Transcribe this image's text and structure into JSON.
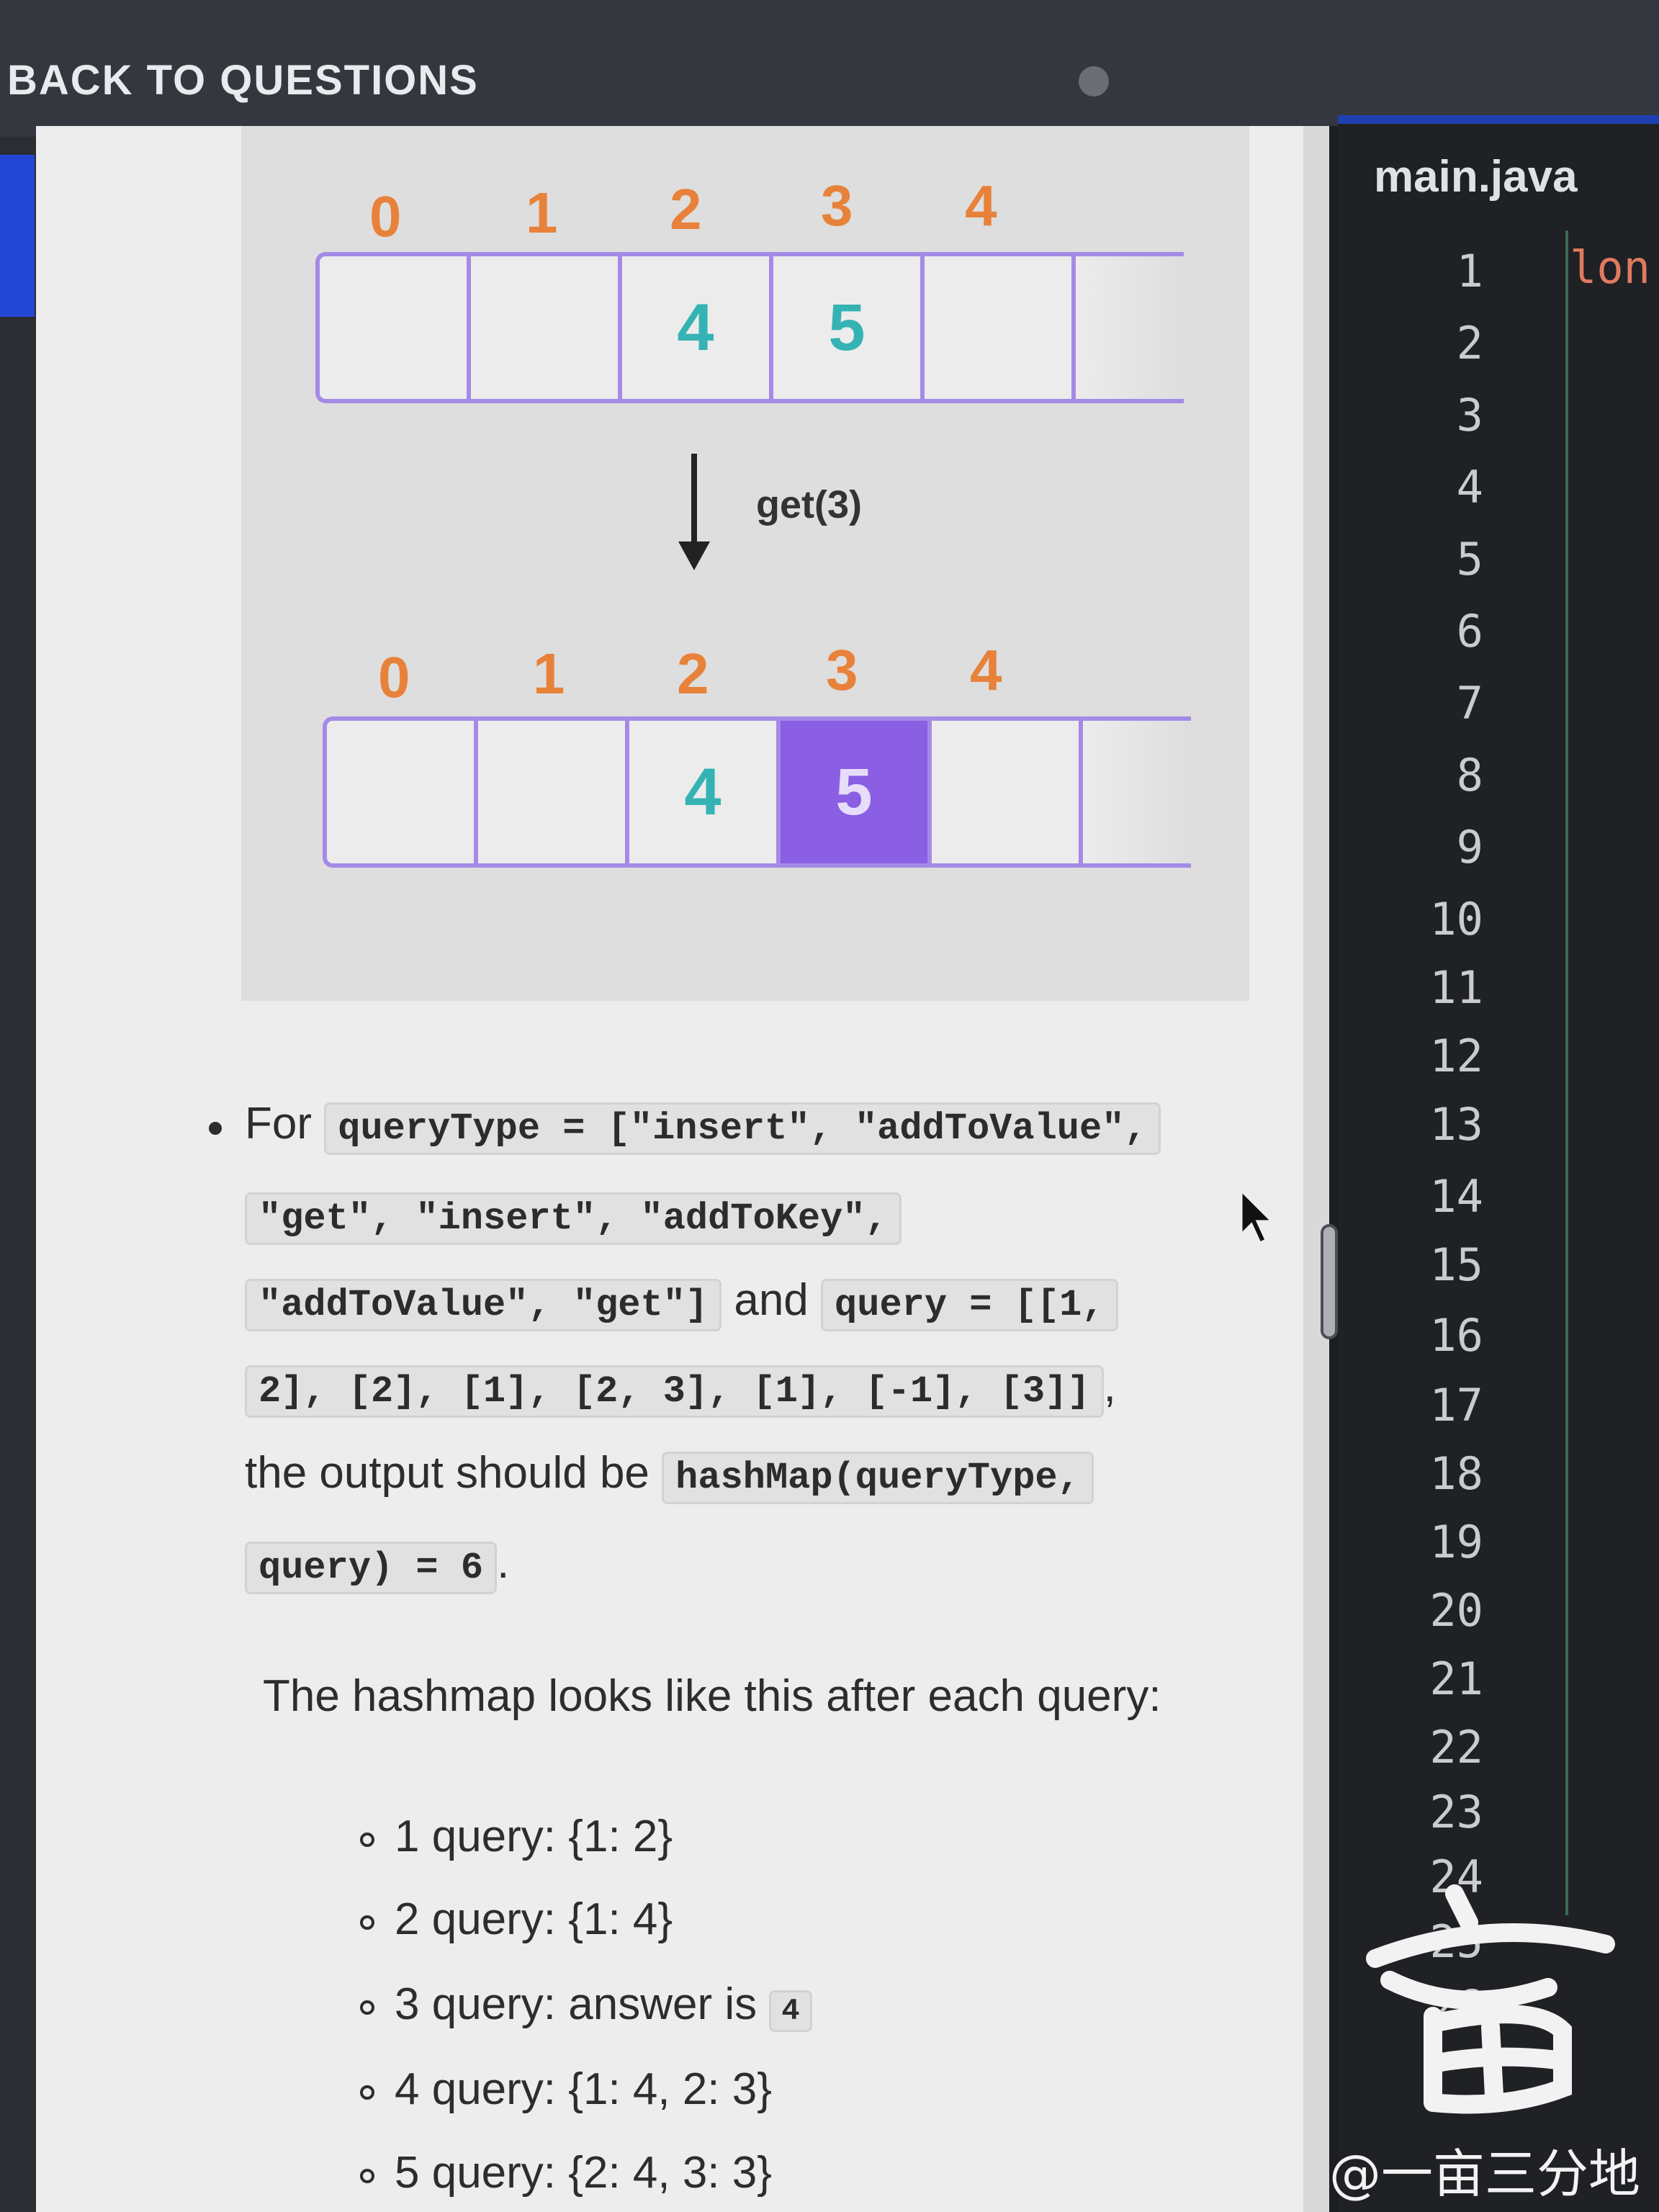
{
  "header": {
    "back_label": "BACK TO QUESTIONS"
  },
  "illustration": {
    "indices": [
      "0",
      "1",
      "2",
      "3",
      "4"
    ],
    "before_cells": [
      "",
      "",
      "4",
      "5",
      ""
    ],
    "after_cells": [
      "",
      "",
      "4",
      "5",
      ""
    ],
    "highlighted_index": 3,
    "operation": "get(3)"
  },
  "example": {
    "for_word": "For",
    "query_type_line1": "queryType = [\"insert\", \"addToValue\",",
    "query_type_line2": "\"get\", \"insert\", \"addToKey\",",
    "query_type_line3": "\"addToValue\", \"get\"]",
    "and_word": "and",
    "query_line1": "query = [[1,",
    "query_line2": "2], [2], [1], [2, 3], [1], [-1], [3]]",
    "comma": ",",
    "output_prefix": "the output should be",
    "output_code1": "hashMap(queryType,",
    "output_code2": "query) = 6",
    "period": "."
  },
  "explanation": {
    "intro": "The hashmap looks like this after each query:",
    "items": [
      {
        "text": "1 query: {1: 2}"
      },
      {
        "text": "2 query: {1: 4}"
      },
      {
        "text": "3 query: answer is",
        "code": "4"
      },
      {
        "text": "4 query: {1: 4, 2: 3}"
      },
      {
        "text": "5 query: {2: 4, 3: 3}"
      }
    ]
  },
  "editor": {
    "file_name": "main.java",
    "line_numbers": [
      "1",
      "2",
      "3",
      "4",
      "5",
      "6",
      "7",
      "8",
      "9",
      "10",
      "11",
      "12",
      "13",
      "14",
      "15",
      "16",
      "17",
      "18",
      "19",
      "20",
      "21",
      "22",
      "23",
      "24",
      "25",
      "26"
    ],
    "first_token": "lon"
  },
  "watermark": {
    "text": "@一亩三分地"
  }
}
